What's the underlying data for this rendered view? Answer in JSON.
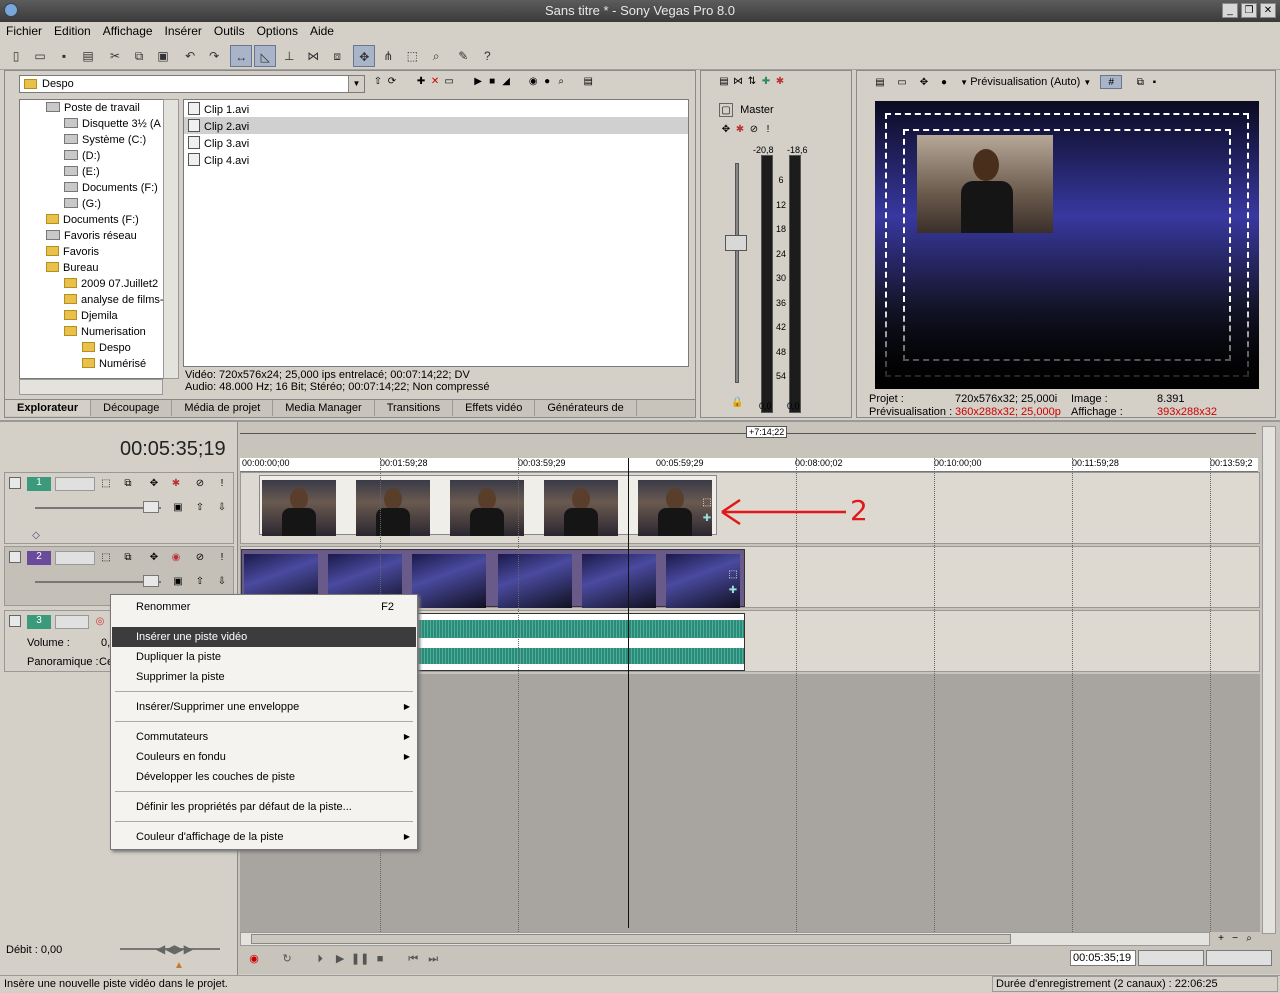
{
  "window": {
    "title": "Sans titre * - Sony Vegas Pro 8.0"
  },
  "menu": [
    "Fichier",
    "Edition",
    "Affichage",
    "Insérer",
    "Outils",
    "Options",
    "Aide"
  ],
  "explorer": {
    "path": "Despo",
    "tree": [
      {
        "label": "Poste de travail",
        "icon": "computer-icon"
      },
      {
        "label": "Disquette 3½ (A",
        "icon": "floppy-icon"
      },
      {
        "label": "Système (C:)",
        "icon": "drive-icon"
      },
      {
        "label": "(D:)",
        "icon": "cd-icon"
      },
      {
        "label": "(E:)",
        "icon": "cd-icon"
      },
      {
        "label": "Documents (F:)",
        "icon": "drive-icon"
      },
      {
        "label": "(G:)",
        "icon": "cd-icon"
      },
      {
        "label": "Documents (F:)",
        "icon": "folder-icon"
      },
      {
        "label": "Favoris réseau",
        "icon": "network-icon"
      },
      {
        "label": "Favoris",
        "icon": "favorites-icon"
      },
      {
        "label": "Bureau",
        "icon": "folder-icon"
      },
      {
        "label": "2009 07.Juillet2",
        "icon": "folder-icon"
      },
      {
        "label": "analyse de films-",
        "icon": "folder-icon"
      },
      {
        "label": "Djemila",
        "icon": "folder-icon"
      },
      {
        "label": "Numerisation",
        "icon": "folder-icon"
      },
      {
        "label": "Despo",
        "icon": "folder-icon"
      },
      {
        "label": "Numérisé",
        "icon": "folder-icon"
      }
    ],
    "files": [
      "Clip 1.avi",
      "Clip 2.avi",
      "Clip 3.avi",
      "Clip 4.avi"
    ],
    "selected_file": "Clip 2.avi",
    "info_video": "Vidéo: 720x576x24; 25,000 ips entrelacé; 00:07:14;22; DV",
    "info_audio": "Audio: 48.000 Hz; 16 Bit; Stéréo; 00:07:14;22; Non compressé"
  },
  "tabs": [
    "Explorateur",
    "Découpage",
    "Média de projet",
    "Media Manager",
    "Transitions",
    "Effets vidéo",
    "Générateurs de"
  ],
  "mixer": {
    "label": "Master",
    "peak_left": "-20,8",
    "peak_right": "-18,6",
    "scale": [
      "6",
      "12",
      "18",
      "24",
      "30",
      "36",
      "42",
      "48",
      "54"
    ],
    "value_left": "0,0",
    "value_right": "0,0"
  },
  "preview": {
    "mode": "Prévisualisation (Auto)",
    "projet_label": "Projet :",
    "projet_value": "720x576x32; 25,000i",
    "prev_label": "Prévisualisation :",
    "prev_value": "360x288x32; 25,000p",
    "image_label": "Image :",
    "image_value": "8.391",
    "affichage_label": "Affichage :",
    "affichage_value": "393x288x32"
  },
  "timeline": {
    "timecode": "00:05:35;19",
    "region_length": "+7:14;22",
    "ruler": [
      "00:00:00;00",
      "00:01:59;28",
      "00:03:59;29",
      "00:05:59;29",
      "00:08:00;02",
      "00:10:00;00",
      "00:11:59;28",
      "00:13:59;2"
    ],
    "tracks": [
      {
        "number": "1",
        "type": "video"
      },
      {
        "number": "2",
        "type": "video"
      },
      {
        "number": "3",
        "type": "audio",
        "volume_label": "Volume :",
        "volume_value": "0,",
        "pan_label": "Panoramique :",
        "pan_value": "Ce"
      }
    ],
    "rate_label": "Débit : 0,00",
    "position": "00:05:35;19"
  },
  "annotations": {
    "one": "1",
    "two": "2"
  },
  "context_menu": [
    {
      "label": "Renommer",
      "shortcut": "F2"
    },
    {
      "label": "Insérer une piste vidéo",
      "highlighted": true
    },
    {
      "label": "Dupliquer la piste"
    },
    {
      "label": "Supprimer la piste"
    },
    {
      "label": "Insérer/Supprimer une enveloppe",
      "submenu": true
    },
    {
      "label": "Commutateurs",
      "submenu": true
    },
    {
      "label": "Couleurs en fondu",
      "submenu": true
    },
    {
      "label": "Développer les couches de piste"
    },
    {
      "label": "Définir les propriétés par défaut de la piste..."
    },
    {
      "label": "Couleur d'affichage de la piste",
      "submenu": true
    }
  ],
  "status": {
    "message": "Insère une nouvelle piste vidéo dans le projet.",
    "record": "Durée d'enregistrement (2 canaux) : 22:06:25"
  }
}
